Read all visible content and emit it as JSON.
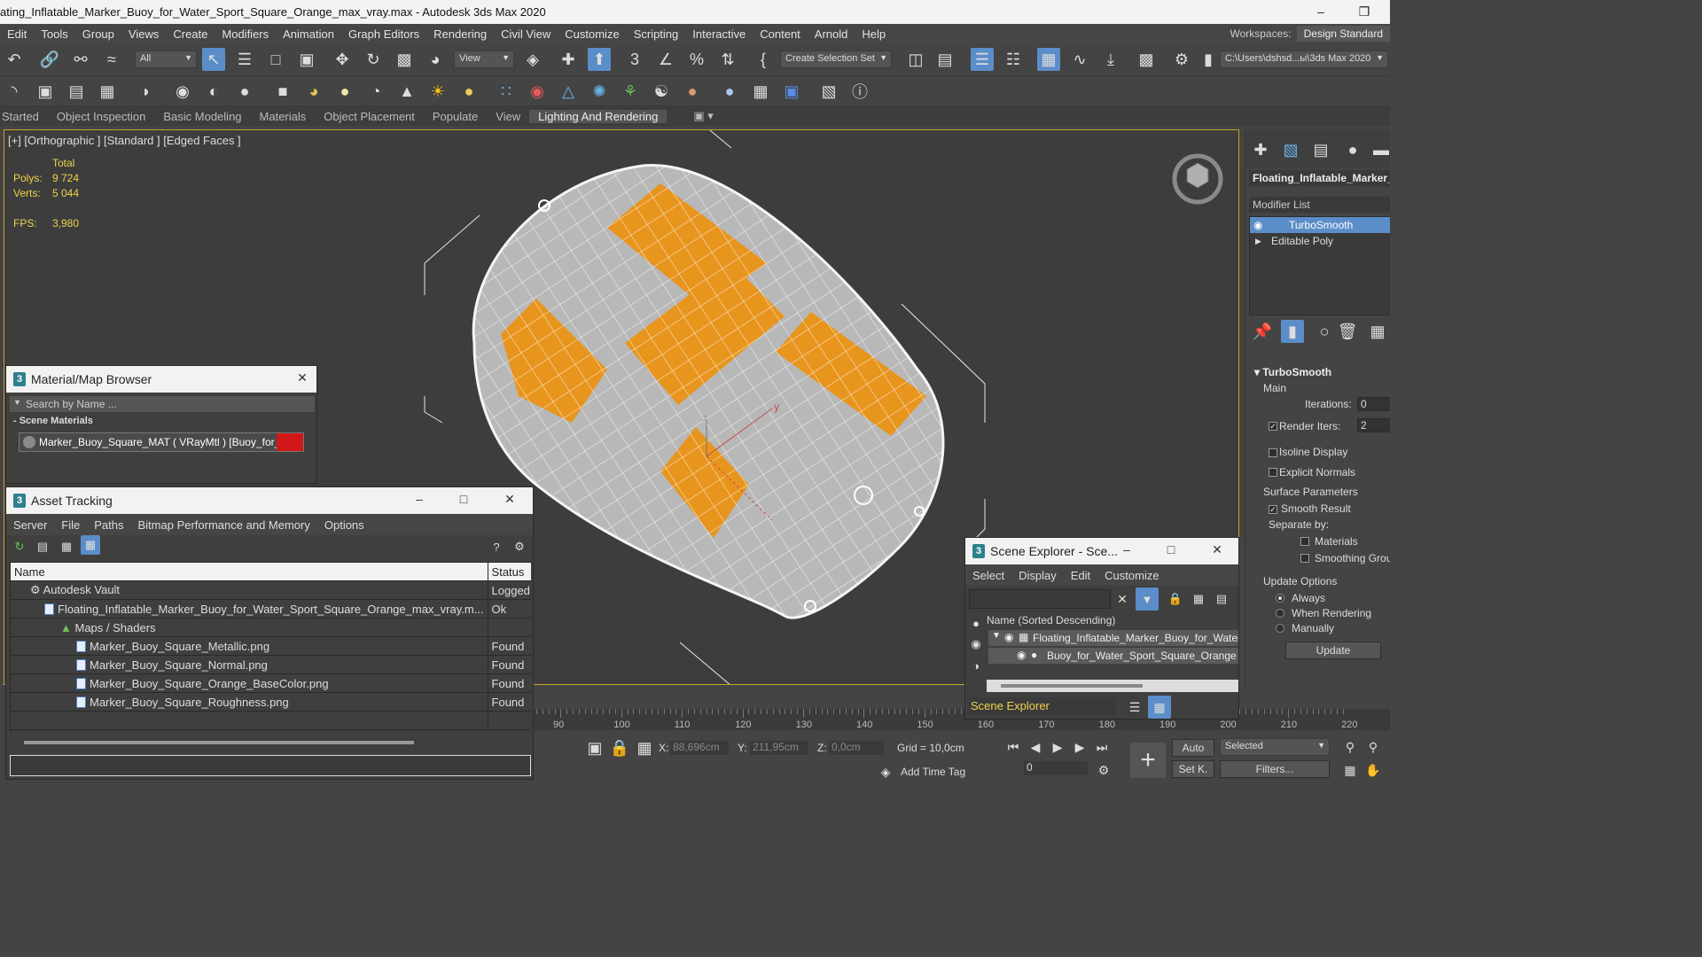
{
  "window": {
    "title": "ating_Inflatable_Marker_Buoy_for_Water_Sport_Square_Orange_max_vray.max - Autodesk 3ds Max 2020"
  },
  "menu": [
    "Edit",
    "Tools",
    "Group",
    "Views",
    "Create",
    "Modifiers",
    "Animation",
    "Graph Editors",
    "Rendering",
    "Civil View",
    "Customize",
    "Scripting",
    "Interactive",
    "Content",
    "Arnold",
    "Help"
  ],
  "workspaces": {
    "label": "Workspaces:",
    "value": "Design Standard"
  },
  "toolbar": {
    "filter": "All",
    "ref_coord": "View",
    "selection_set": "Create Selection Set",
    "project_path": "C:\\Users\\dshsd...ы\\3ds Max 2020"
  },
  "ribbon_tabs": [
    "Started",
    "Object Inspection",
    "Basic Modeling",
    "Materials",
    "Object Placement",
    "Populate",
    "View",
    "Lighting And Rendering"
  ],
  "viewport": {
    "label": "[+] [Orthographic ] [Standard ] [Edged Faces ]",
    "stats_header": "Total",
    "polys_label": "Polys:",
    "polys": "9 724",
    "verts_label": "Verts:",
    "verts": "5 044",
    "fps_label": "FPS:",
    "fps": "3,980",
    "axis_x": "x",
    "axis_y": "y",
    "axis_z": "z"
  },
  "command_panel": {
    "object_name": "Floating_Inflatable_Marker_",
    "modifier_list": "Modifier List",
    "stack": [
      "TurboSmooth",
      "Editable Poly"
    ],
    "turbosmooth": {
      "header": "TurboSmooth",
      "main": "Main",
      "iterations_label": "Iterations:",
      "iterations": "0",
      "render_iters_label": "Render Iters:",
      "render_iters": "2",
      "isoline": "Isoline Display",
      "explicit_normals": "Explicit Normals",
      "surface_params": "Surface Parameters",
      "smooth_result": "Smooth Result",
      "separate_by": "Separate by:",
      "materials": "Materials",
      "smoothing_groups": "Smoothing Groups",
      "update_options": "Update Options",
      "always": "Always",
      "when_rendering": "When Rendering",
      "manually": "Manually",
      "update": "Update"
    }
  },
  "material_browser": {
    "title": "Material/Map Browser",
    "search_placeholder": "Search by Name ...",
    "group": "- Scene Materials",
    "item": "Marker_Buoy_Square_MAT  ( VRayMtl )  [Buoy_for_Wa..."
  },
  "asset_tracking": {
    "title": "Asset Tracking",
    "menu": [
      "Server",
      "File",
      "Paths",
      "Bitmap Performance and Memory",
      "Options"
    ],
    "col_name": "Name",
    "col_status": "Status",
    "rows": [
      {
        "name": "Autodesk Vault",
        "status": "Logged O..."
      },
      {
        "name": "Floating_Inflatable_Marker_Buoy_for_Water_Sport_Square_Orange_max_vray.m...",
        "status": "Ok"
      },
      {
        "name": "Maps / Shaders",
        "status": ""
      },
      {
        "name": "Marker_Buoy_Square_Metallic.png",
        "status": "Found"
      },
      {
        "name": "Marker_Buoy_Square_Normal.png",
        "status": "Found"
      },
      {
        "name": "Marker_Buoy_Square_Orange_BaseColor.png",
        "status": "Found"
      },
      {
        "name": "Marker_Buoy_Square_Roughness.png",
        "status": "Found"
      }
    ]
  },
  "scene_explorer": {
    "title": "Scene Explorer - Sce...",
    "menu": [
      "Select",
      "Display",
      "Edit",
      "Customize"
    ],
    "column": "Name (Sorted Descending)",
    "items": [
      "Floating_Inflatable_Marker_Buoy_for_Water_Sp",
      "Buoy_for_Water_Sport_Square_Orange"
    ],
    "footer": "Scene Explorer"
  },
  "timeline": {
    "labels": [
      "90",
      "100",
      "110",
      "120",
      "130",
      "140",
      "150",
      "160",
      "170",
      "180",
      "190",
      "200",
      "210",
      "220"
    ]
  },
  "status": {
    "x_label": "X:",
    "x": "88,696cm",
    "y_label": "Y:",
    "y": "211,95cm",
    "z_label": "Z:",
    "z": "0,0cm",
    "grid": "Grid = 10,0cm",
    "add_time_tag": "Add Time Tag",
    "auto": "Auto",
    "selected": "Selected",
    "set_key": "Set K.",
    "filters": "Filters...",
    "frame": "0"
  },
  "colors": {
    "accent": "#5b8dc9",
    "viewport_border": "#c9a227",
    "buoy_orange": "#e8951e"
  }
}
